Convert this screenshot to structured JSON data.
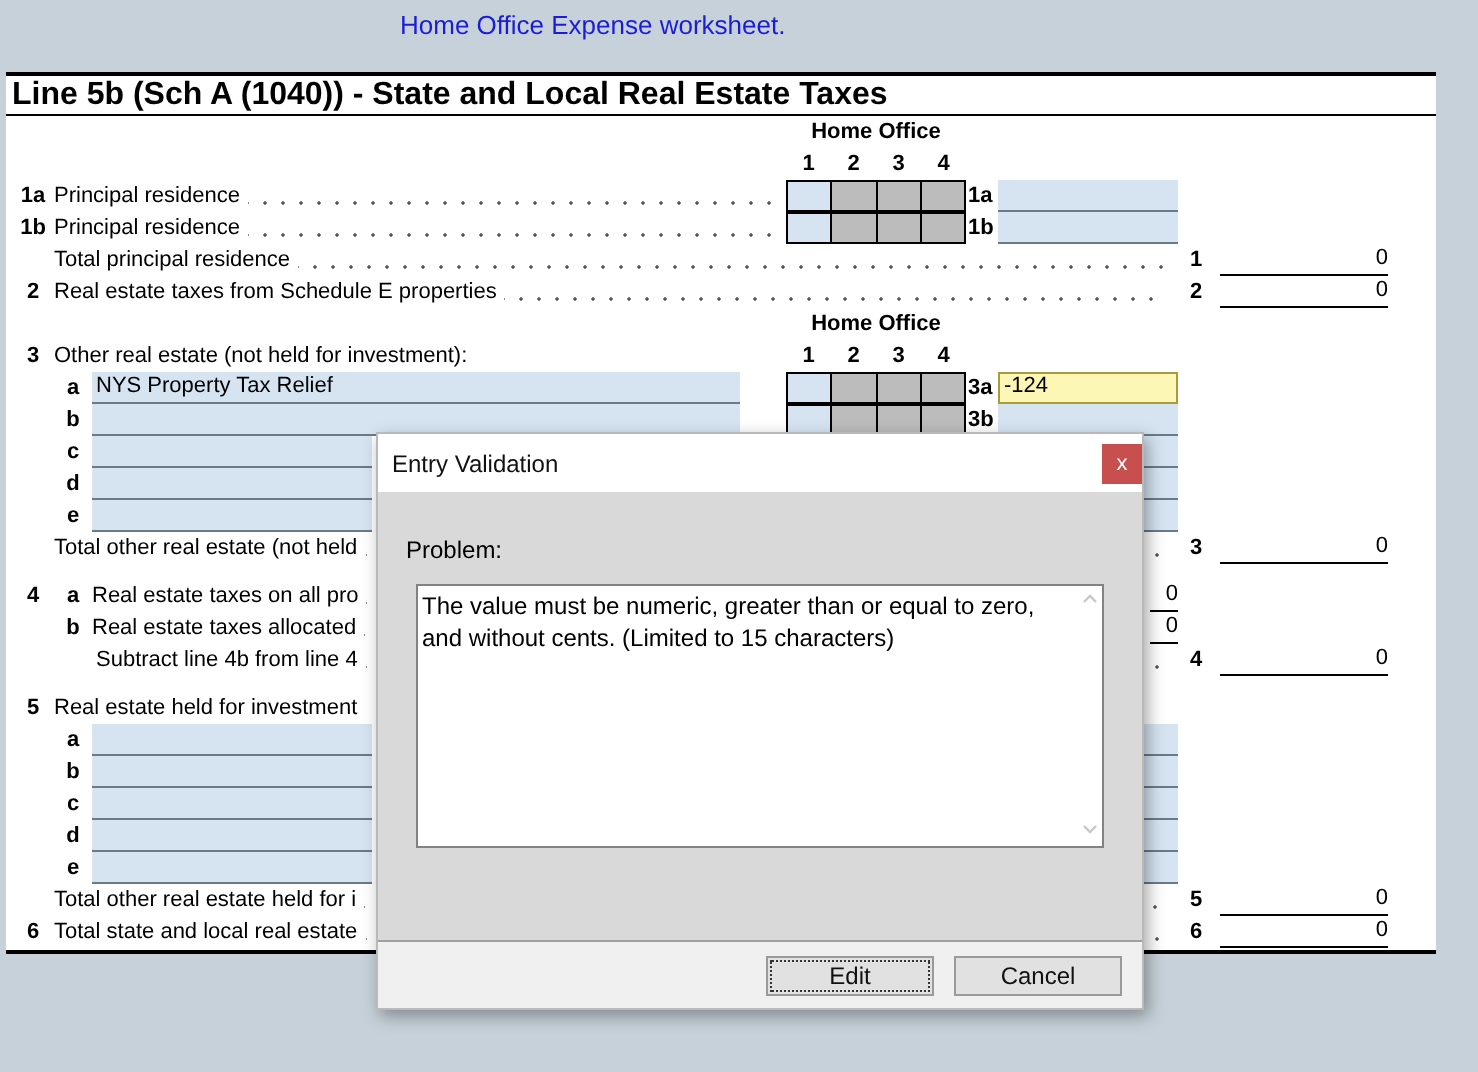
{
  "header_note": "Home Office Expense worksheet.",
  "form": {
    "title": "Line 5b (Sch A (1040)) - State and Local Real Estate Taxes",
    "rows": [
      {
        "kind": "ho_header",
        "label": "Home Office"
      },
      {
        "kind": "ho_columns",
        "columns": [
          "1",
          "2",
          "3",
          "4"
        ]
      },
      {
        "kind": "entry",
        "num": "1a",
        "text": "Principal residence",
        "home_office": [
          {
            "disabled": false
          },
          {
            "disabled": true
          },
          {
            "disabled": true
          },
          {
            "disabled": true
          }
        ],
        "box_label": "1a",
        "box_highlighted": false
      },
      {
        "kind": "entry",
        "num": "1b",
        "text": "Principal residence",
        "home_office": [
          {
            "disabled": false
          },
          {
            "disabled": true
          },
          {
            "disabled": true
          },
          {
            "disabled": true
          }
        ],
        "box_label": "1b",
        "box_highlighted": false
      },
      {
        "kind": "total",
        "text": "Total principal residence",
        "line": "1",
        "value": "0"
      },
      {
        "kind": "total",
        "num": "2",
        "text": "Real estate taxes from Schedule E properties",
        "line": "2",
        "value": "0"
      },
      {
        "kind": "ho_header",
        "label": "Home Office"
      },
      {
        "kind": "section",
        "num": "3",
        "text": "Other real estate (not held for investment):",
        "columns": [
          "1",
          "2",
          "3",
          "4"
        ]
      },
      {
        "kind": "field_entry",
        "letter": "a",
        "field": "NYS Property Tax Relief",
        "home_office": [
          {
            "disabled": false
          },
          {
            "disabled": true
          },
          {
            "disabled": true
          },
          {
            "disabled": true
          }
        ],
        "box_label": "3a",
        "box_value": "-124",
        "box_highlighted": true
      },
      {
        "kind": "field_entry",
        "letter": "b",
        "home_office": [
          {
            "disabled": false
          },
          {
            "disabled": true
          },
          {
            "disabled": true
          },
          {
            "disabled": true
          }
        ],
        "box_label": "3b",
        "box_highlighted": false
      },
      {
        "kind": "blank",
        "letter": "c"
      },
      {
        "kind": "blank",
        "letter": "d"
      },
      {
        "kind": "blank",
        "letter": "e"
      },
      {
        "kind": "total",
        "text": "Total other real estate (not held",
        "line": "3",
        "value": "0"
      },
      {
        "kind": "subvalue",
        "gap": true,
        "num": "4",
        "letter": "a",
        "text": "Real estate taxes on all pro",
        "value": "0"
      },
      {
        "kind": "subvalue",
        "letter": "b",
        "text": "Real estate taxes allocated",
        "value": "0"
      },
      {
        "kind": "total",
        "indent": true,
        "text": "Subtract line 4b from  line 4",
        "line": "4",
        "value": "0"
      },
      {
        "kind": "section",
        "gap": true,
        "num": "5",
        "text": "Real estate held for investment"
      },
      {
        "kind": "blank",
        "letter": "a"
      },
      {
        "kind": "blank",
        "letter": "b"
      },
      {
        "kind": "blank",
        "letter": "c"
      },
      {
        "kind": "blank",
        "letter": "d"
      },
      {
        "kind": "blank",
        "letter": "e"
      },
      {
        "kind": "total",
        "text": "Total other real estate held for i",
        "line": "5",
        "value": "0"
      },
      {
        "kind": "total",
        "num": "6",
        "text": "Total state and local real estate",
        "line": "6",
        "value": "0"
      }
    ]
  },
  "dialog": {
    "title": "Entry Validation",
    "close": "x",
    "problem_label": "Problem:",
    "message": "The value must be numeric, greater than or equal to zero, and without cents. (Limited to 15 characters)",
    "buttons": [
      {
        "label": "Edit",
        "focused": true
      },
      {
        "label": "Cancel",
        "focused": false
      }
    ]
  }
}
